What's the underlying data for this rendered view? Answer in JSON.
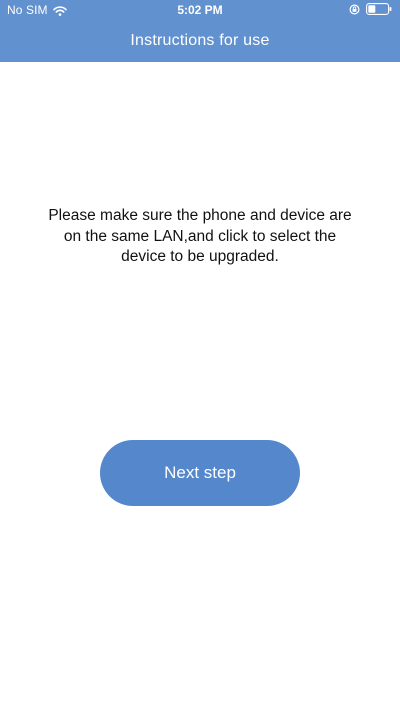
{
  "status_bar": {
    "carrier": "No SIM",
    "time": "5:02 PM",
    "icons": [
      "wifi-icon",
      "rotation-lock-icon",
      "battery-icon"
    ]
  },
  "header": {
    "title": "Instructions for use",
    "background_color": "#6291d0"
  },
  "main": {
    "instruction_text": "Please make sure the phone and device are on the same LAN,and click to select the device to be upgraded.",
    "next_button_label": "Next step",
    "button_color": "#5487cc"
  }
}
